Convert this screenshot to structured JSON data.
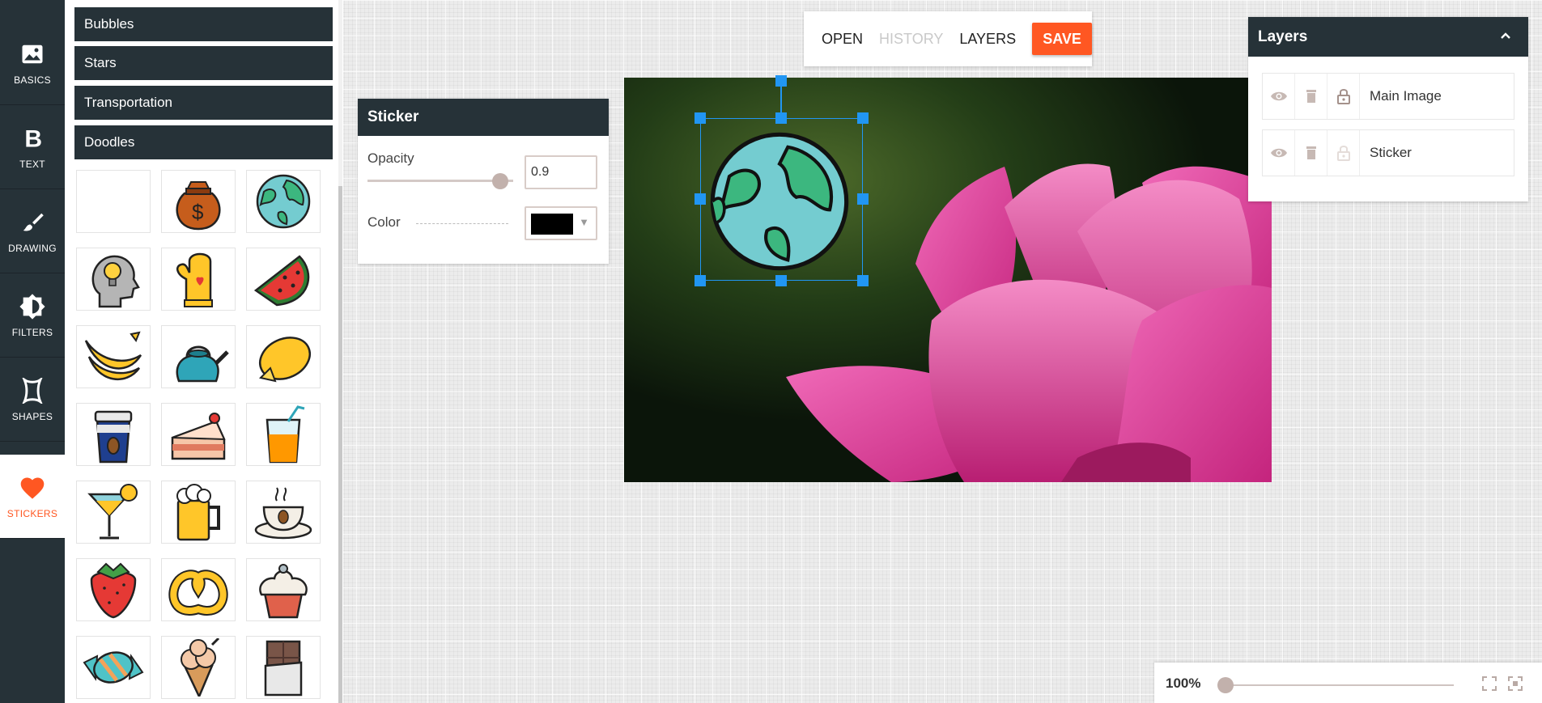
{
  "nav": {
    "items": [
      {
        "label": "BASICS",
        "icon": "image-icon"
      },
      {
        "label": "TEXT",
        "icon": "bold-icon"
      },
      {
        "label": "DRAWING",
        "icon": "brush-icon"
      },
      {
        "label": "FILTERS",
        "icon": "brightness-icon"
      },
      {
        "label": "SHAPES",
        "icon": "shape-icon"
      },
      {
        "label": "STICKERS",
        "icon": "heart-icon",
        "active": true
      }
    ]
  },
  "sticker_panel": {
    "categories": [
      "Bubbles",
      "Stars",
      "Transportation",
      "Doodles"
    ],
    "stickers": [
      "blank",
      "money-bag",
      "globe",
      "head-lightbulb",
      "oven-mitt",
      "watermelon",
      "bananas",
      "teapot",
      "lemon",
      "coffee-cup",
      "cake-slice",
      "juice-glass",
      "cocktail",
      "beer-mug",
      "coffee-saucer",
      "strawberry",
      "pretzel",
      "cupcake",
      "candy",
      "ice-cream-cone",
      "chocolate-bar"
    ]
  },
  "toolbar": {
    "open": "OPEN",
    "history": "HISTORY",
    "layers": "LAYERS",
    "save": "SAVE"
  },
  "sticker_props": {
    "title": "Sticker",
    "opacity_label": "Opacity",
    "opacity_value": "0.9",
    "opacity_level": 0.9,
    "color_label": "Color",
    "color_value": "#000000"
  },
  "layers_panel": {
    "title": "Layers",
    "layers": [
      {
        "name": "Main Image",
        "locked": true
      },
      {
        "name": "Sticker",
        "locked": false
      }
    ]
  },
  "zoom": {
    "value": "100%"
  },
  "colors": {
    "dark": "#263238",
    "accent": "#ff5722",
    "selection": "#2196f3"
  }
}
